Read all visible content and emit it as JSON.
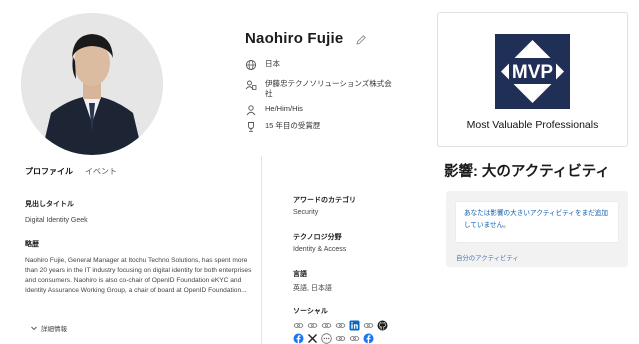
{
  "profile": {
    "name": "Naohiro Fujie",
    "country": "日本",
    "company": "伊藤忠テクノソリューションズ株式会社",
    "pronouns": "He/Him/His",
    "award_years": "15 年目の受賞歴"
  },
  "tabs": [
    {
      "label": "プロファイル",
      "active": true
    },
    {
      "label": "イベント",
      "active": false
    }
  ],
  "headline": {
    "label": "見出しタイトル",
    "value": "Digital Identity Geek"
  },
  "bio": {
    "label": "略歴",
    "text": "Naohiro Fujie, General Manager at Itochu Techno Solutions, has spent more than 20 years in the IT industry focusing on digital identity for both enterprises and consumers. Naohiro is also co-chair of OpenID Foundation eKYC and Identity Assurance Working Group, a chair of board at OpenID Foundation...",
    "more_label": "詳細情報"
  },
  "award_category": {
    "label": "アワードのカテゴリ",
    "value": "Security"
  },
  "technology": {
    "label": "テクノロジ分野",
    "value": "Identity & Access"
  },
  "language": {
    "label": "言語",
    "value": "英語, 日本語"
  },
  "social": {
    "label": "ソーシャル",
    "row1": [
      "link-icon",
      "link-icon",
      "link-icon",
      "link-icon",
      "linkedin-icon",
      "link-icon",
      "github-icon"
    ],
    "row2": [
      "facebook-icon",
      "x-icon",
      "more-icon",
      "link-icon",
      "link-icon",
      "facebook-icon"
    ]
  },
  "mvp": {
    "logo_text": "MVP",
    "caption": "Most Valuable Professionals",
    "logo_color": "#1f2f55"
  },
  "impact": {
    "title": "影響: 大のアクティビティ",
    "message": "あなたは影響の大きいアクティビティをまだ追加していません。",
    "link": "自分のアクティビティ"
  },
  "colors": {
    "link": "#0f5fb5",
    "facebook": "#1877f2",
    "linkedin": "#0a66c2"
  }
}
